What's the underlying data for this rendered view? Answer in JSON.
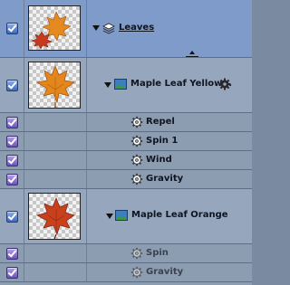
{
  "layers": [
    {
      "name": "Leaves",
      "type": "group",
      "enabled": true,
      "colors": {
        "row": "#7f9bc9"
      }
    },
    {
      "name": "Maple Leaf Yellow...",
      "type": "image",
      "enabled": true
    },
    {
      "name": "Repel",
      "type": "behavior",
      "enabled": true
    },
    {
      "name": "Spin 1",
      "type": "behavior",
      "enabled": true
    },
    {
      "name": "Wind",
      "type": "behavior",
      "enabled": true
    },
    {
      "name": "Gravity",
      "type": "behavior",
      "enabled": true
    },
    {
      "name": "Maple Leaf Orange",
      "type": "image",
      "enabled": true
    },
    {
      "name": "Spin",
      "type": "behavior",
      "enabled": true,
      "dimmed": true
    },
    {
      "name": "Gravity",
      "type": "behavior",
      "enabled": true,
      "dimmed": true
    }
  ],
  "colors": {
    "group_row": "#7f9bc9",
    "image_row": "#95a6bd",
    "behavior_row": "#8c9cb1",
    "checkbox_blue": "#3d68bf",
    "checkbox_purple": "#6a52b8"
  },
  "icons": {
    "group": "layers-stack-icon",
    "image": "image-layer-icon",
    "behavior": "gear-icon",
    "resize": "vertical-resize-cursor-icon"
  }
}
